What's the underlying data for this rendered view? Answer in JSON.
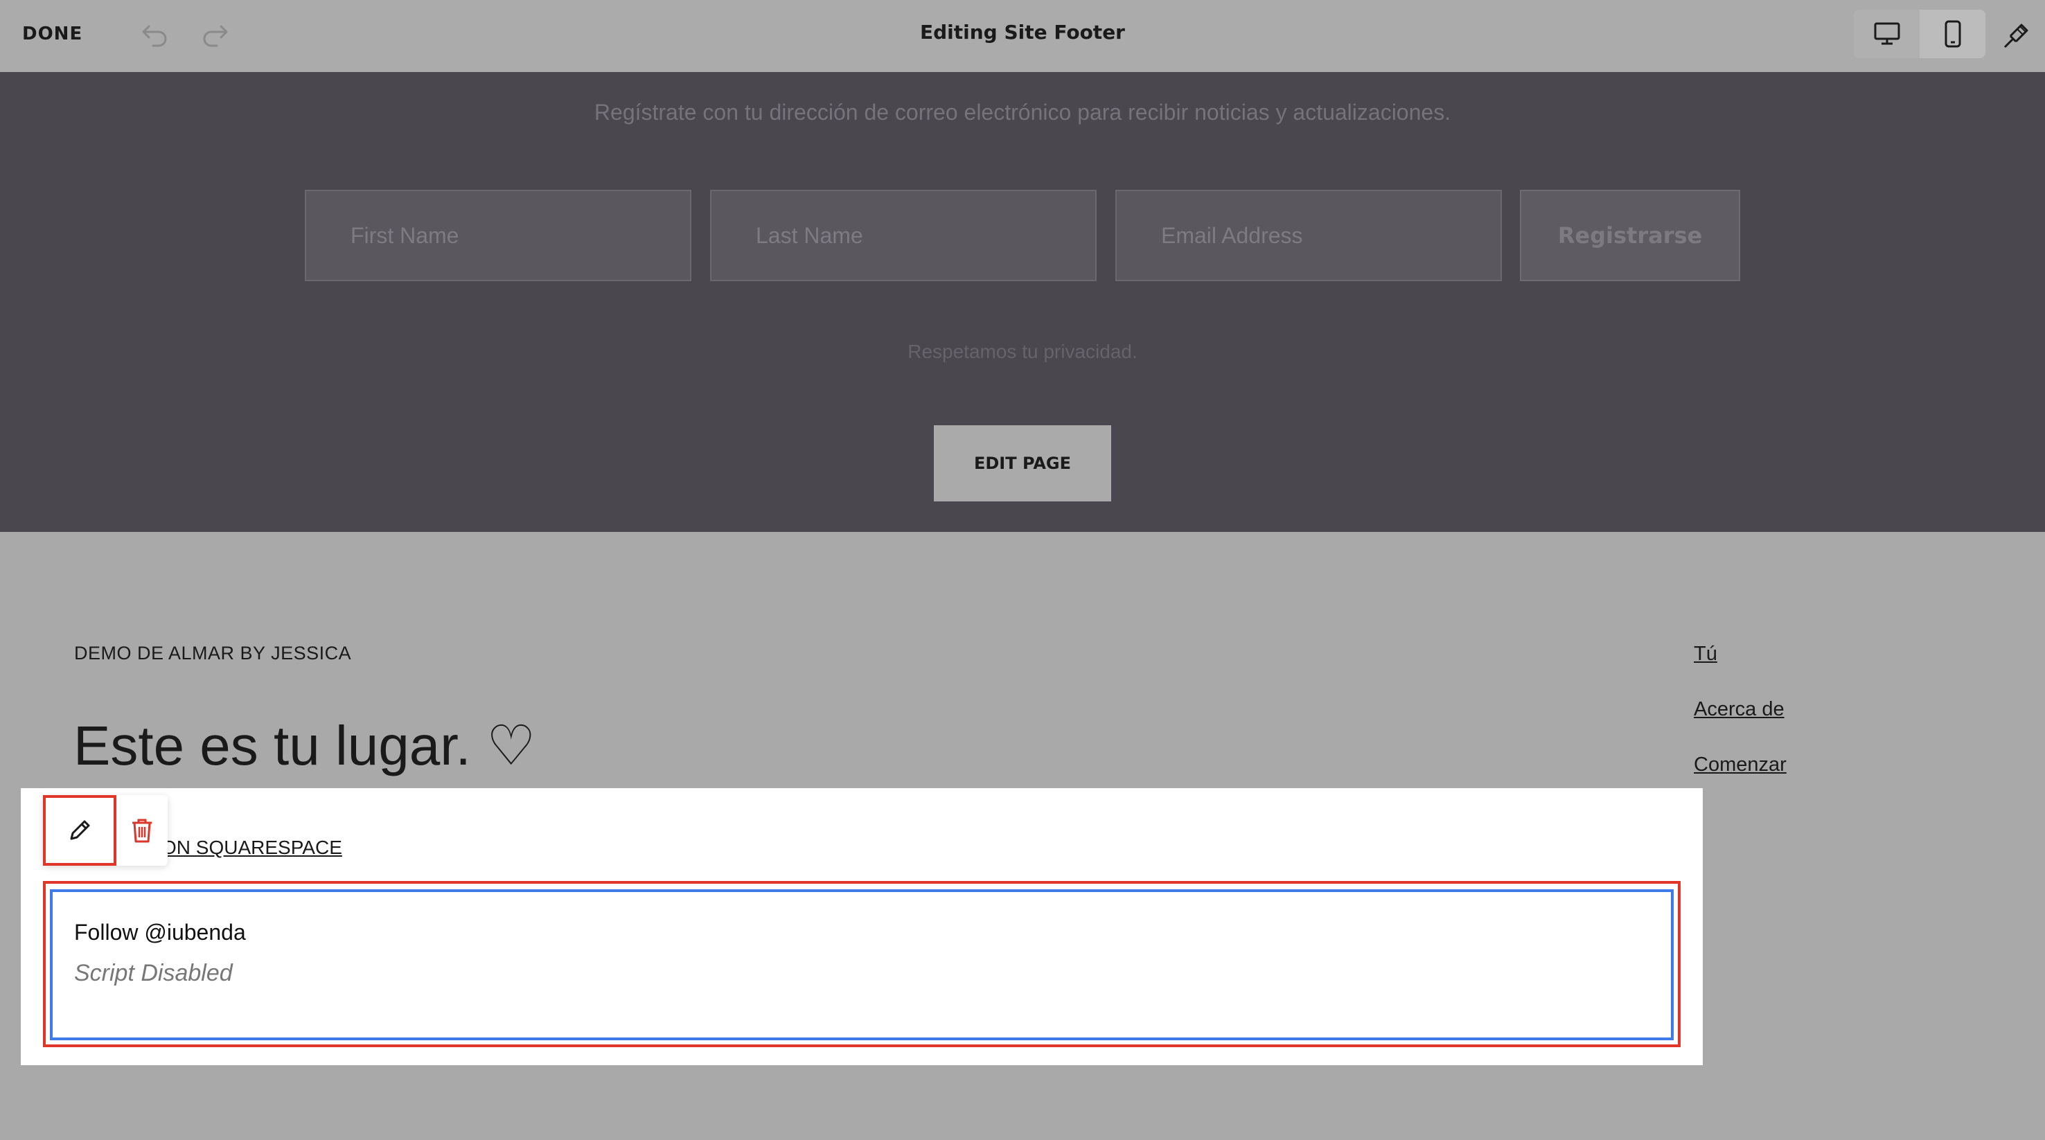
{
  "toolbar": {
    "done_label": "DONE",
    "title": "Editing Site Footer",
    "icons": [
      "undo-icon",
      "redo-icon",
      "desktop-icon",
      "mobile-icon",
      "paintbrush-icon"
    ]
  },
  "newsletter": {
    "description": "Regístrate con tu dirección de correo electrónico para recibir noticias y actualizaciones.",
    "first_name_placeholder": "First Name",
    "last_name_placeholder": "Last Name",
    "email_placeholder": "Email Address",
    "submit_label": "Registrarse",
    "privacy_note": "Respetamos tu privacidad.",
    "edit_page_label": "EDIT PAGE"
  },
  "footer": {
    "brand": "DEMO DE ALMAR BY JESSICA",
    "headline": "Este es tu lugar. ♡",
    "squarespace_link": "ON SQUARESPACE",
    "nav": [
      {
        "label": "Tú"
      },
      {
        "label": "Acerca de"
      },
      {
        "label": "Comenzar"
      }
    ]
  },
  "embed_block": {
    "title": "Follow @iubenda",
    "status": "Script Disabled"
  },
  "colors": {
    "selection_red": "#e0362a",
    "selection_blue": "#3f7be8",
    "delete_red": "#d9362c"
  }
}
